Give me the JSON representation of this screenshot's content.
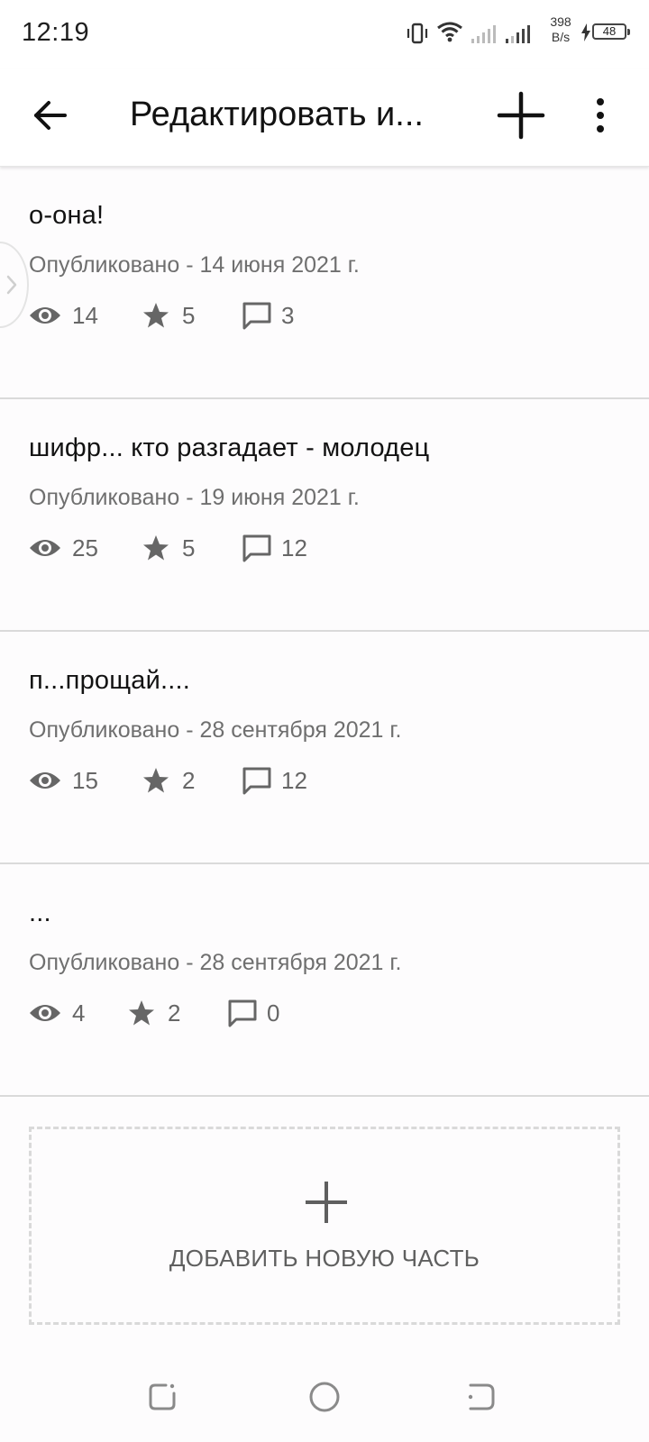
{
  "status_bar": {
    "time": "12:19",
    "net_speed_value": "398",
    "net_speed_unit": "B/s",
    "battery": "48"
  },
  "header": {
    "title": "Редактировать и..."
  },
  "parts": [
    {
      "title": "о-она!",
      "date": "Опубликовано - 14 июня 2021 г.",
      "views": "14",
      "votes": "5",
      "comments": "3"
    },
    {
      "title": "шифр... кто разгадает - молодец",
      "date": "Опубликовано - 19 июня 2021 г.",
      "views": "25",
      "votes": "5",
      "comments": "12"
    },
    {
      "title": "п...прощай....",
      "date": "Опубликовано - 28 сентября 2021 г.",
      "views": "15",
      "votes": "2",
      "comments": "12"
    },
    {
      "title": "...",
      "date": "Опубликовано - 28 сентября 2021 г.",
      "views": "4",
      "votes": "2",
      "comments": "0"
    }
  ],
  "add_part": {
    "label": "ДОБАВИТЬ НОВУЮ ЧАСТЬ"
  },
  "icons": {
    "back": "arrow-left-icon",
    "add": "plus-icon",
    "more": "more-vert-icon",
    "views": "eye-icon",
    "votes": "star-icon",
    "comments": "comment-icon"
  },
  "colors": {
    "text_primary": "#121212",
    "text_secondary": "#6f6f6f",
    "icon_gray": "#666666",
    "divider": "#dadada"
  }
}
